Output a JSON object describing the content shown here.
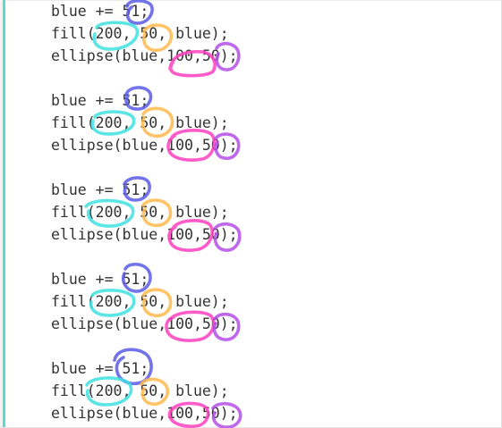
{
  "code": {
    "lines": [
      "blue += 51;",
      "fill(200, 50, blue);",
      "ellipse(blue,100,50);",
      "blue += 51;",
      "fill(200, 50, blue);",
      "ellipse(blue,100,50);",
      "blue += 51;",
      "fill(200, 50, blue);",
      "ellipse(blue,100,50);",
      "blue += 51;",
      "fill(200, 50, blue);",
      "ellipse(blue,100,50);",
      "blue += 51;",
      "fill(200, 50, blue);",
      "ellipse(blue,100,50);"
    ]
  },
  "annotations": {
    "color_blue_increment": "#5a5ae6",
    "color_fill_red": "#3fe0e0",
    "color_fill_green": "#ffb84d",
    "color_ellipse_width": "#ff3fc0",
    "color_ellipse_height": "#b44ee8"
  },
  "theme": {
    "accent_bar": "#5fd9cd",
    "text": "#333333",
    "background": "#ffffff"
  }
}
